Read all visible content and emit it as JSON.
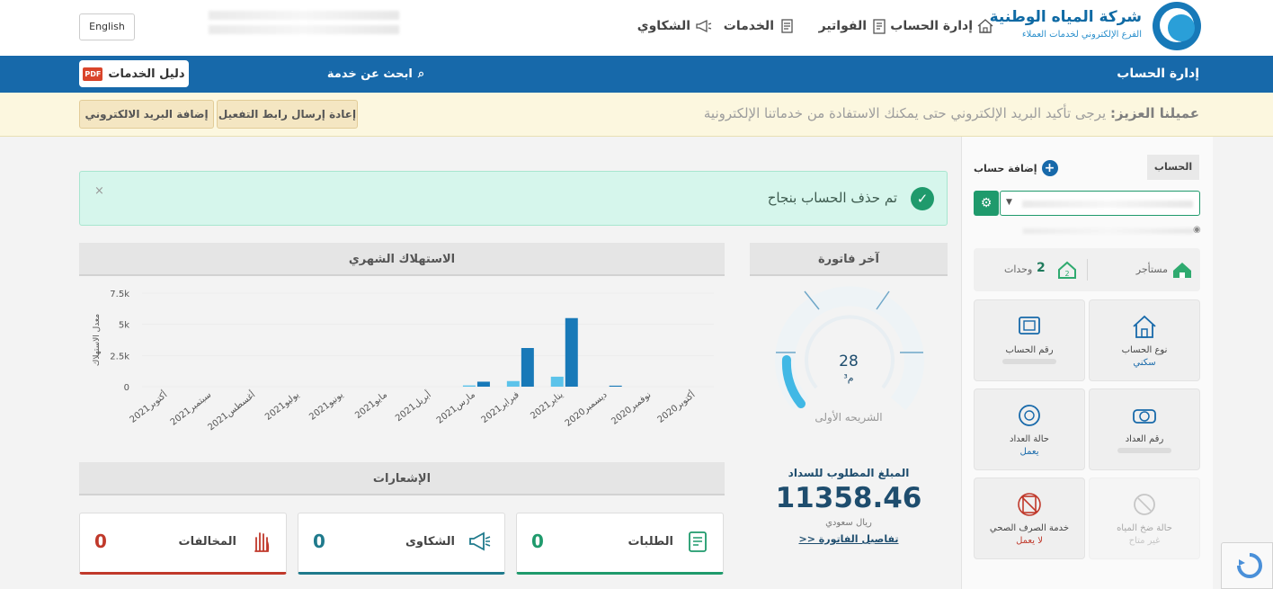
{
  "header": {
    "brand_title": "شركة المياه الوطنية",
    "brand_subtitle": "الفرع الإلكتروني لخدمات العملاء",
    "nav": {
      "account": "إدارة الحساب",
      "bills": "الفواتير",
      "services": "الخدمات",
      "complaints": "الشكاوي"
    },
    "language_button": "English"
  },
  "bluebar": {
    "title": "إدارة الحساب",
    "search_label": "ابحث عن خدمة",
    "guide_label": "دليل الخدمات",
    "pdf_badge": "PDF"
  },
  "warning": {
    "prefix": "عميلنا العزيز:",
    "text": " يرجى تأكيد البريد الإلكتروني حتى يمكنك الاستفادة من خدماتنا الإلكترونية",
    "resend_button": "إعادة إرسال رابط التفعيل",
    "add_email_button": "إضافة البريد الالكتروني"
  },
  "sidebar": {
    "account_tab": "الحساب",
    "add_account": "إضافة حساب",
    "units_label": "وحدات",
    "units_count": "2",
    "tenant_label": "مستأجر",
    "tiles": [
      {
        "label": "نوع الحساب",
        "value": "سكني"
      },
      {
        "label": "رقم الحساب",
        "value": ""
      },
      {
        "label": "رقم العداد",
        "value": ""
      },
      {
        "label": "حالة العداد",
        "value": "يعمل"
      },
      {
        "label": "حالة ضخ المياه",
        "value": "غير متاح"
      },
      {
        "label": "خدمة الصرف الصحي",
        "value": "لا يعمل"
      }
    ]
  },
  "alert": {
    "message": "تم حذف الحساب بنجاح",
    "close": "×"
  },
  "consumption": {
    "title": "الاستهلاك الشهري"
  },
  "last_bill": {
    "title": "آخر فاتورة",
    "reading": "28",
    "unit": "م³",
    "tier": "الشريحه الأولى",
    "due_label": "المبلغ المطلوب للسداد",
    "amount": "11358.46",
    "currency": "ريال سعودي",
    "details_link": "تفاصيل الفاتورة <<"
  },
  "notifications": {
    "title": "الإشعارات",
    "cards": [
      {
        "label": "الطلبات",
        "count": "0",
        "color": "#1f9a6c"
      },
      {
        "label": "الشكاوى",
        "count": "0",
        "color": "#1f7a8c"
      },
      {
        "label": "المخالفات",
        "count": "0",
        "color": "#c0392b"
      }
    ]
  },
  "chart_data": {
    "type": "bar",
    "ylabel": "معدل الاستهلاك",
    "yticks": [
      "0",
      "2.5k",
      "5k",
      "7.5k"
    ],
    "ylim": [
      0,
      7500
    ],
    "grid": true,
    "categories": [
      "أكتوبر2020",
      "نوفمبر2020",
      "ديسمبر2020",
      "يناير2021",
      "فبراير2021",
      "مارس2021",
      "أبريل2021",
      "مايو2021",
      "يونيو2021",
      "يوليو2021",
      "أغسطس2021",
      "سبتمبر2021",
      "أكتوبر2021"
    ],
    "series": [
      {
        "color": "#5cc3ea",
        "values": [
          0,
          0,
          0,
          800,
          450,
          100,
          0,
          0,
          0,
          0,
          0,
          0,
          0
        ]
      },
      {
        "color": "#1879b8",
        "values": [
          0,
          0,
          80,
          5500,
          3100,
          400,
          0,
          0,
          0,
          0,
          0,
          0,
          0
        ]
      }
    ]
  }
}
